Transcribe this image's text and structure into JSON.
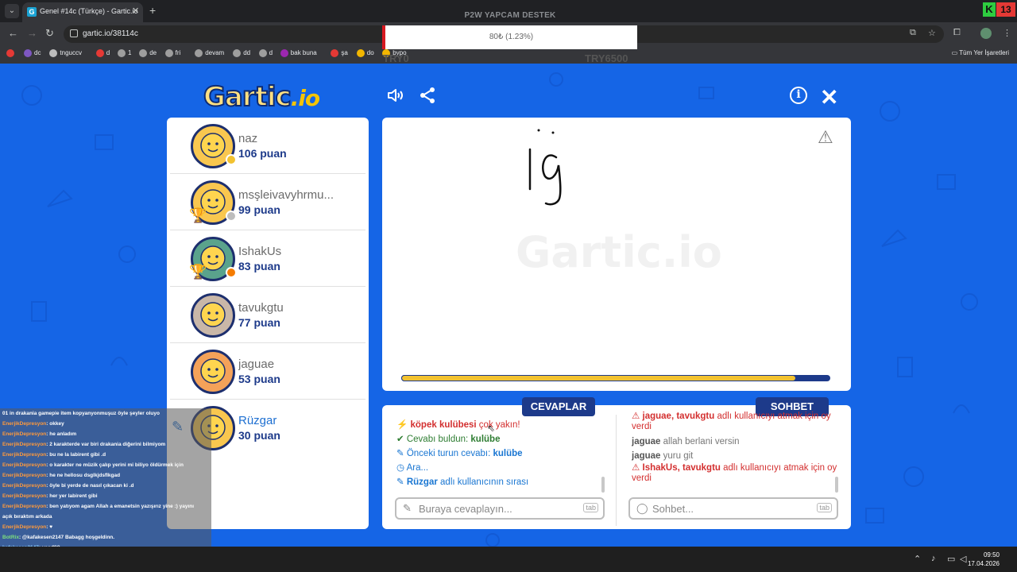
{
  "browser": {
    "tab_title": "Genel #14c (Türkçe) - Gartic.io",
    "tab_favicon": "G",
    "url": "gartic.io/38114c",
    "stream_title": "P2W YAPCAM DESTEK",
    "k_badge": "K",
    "k_number": "13",
    "bookmarks": [
      {
        "label": "",
        "color": "#e53935"
      },
      {
        "label": "dc",
        "color": "#7e57c2"
      },
      {
        "label": "tnguccv",
        "color": "#bdbdbd"
      },
      {
        "label": "d",
        "color": "#e53935"
      },
      {
        "label": "1",
        "color": "#9e9e9e"
      },
      {
        "label": "de",
        "color": "#9e9e9e"
      },
      {
        "label": "fri",
        "color": "#9e9e9e"
      },
      {
        "label": "devam",
        "color": "#9e9e9e"
      },
      {
        "label": "dd",
        "color": "#9e9e9e"
      },
      {
        "label": "d",
        "color": "#9e9e9e"
      },
      {
        "label": "bak buna",
        "color": "#9c27b0"
      },
      {
        "label": "şa",
        "color": "#e53935"
      },
      {
        "label": "do",
        "color": "#f2b600"
      },
      {
        "label": "bypo",
        "color": "#f2b600"
      }
    ],
    "all_bookmarks": "Tüm Yer İşaretleri"
  },
  "donation": {
    "text": "80₺ (1.23%)",
    "min": "TRY0",
    "max": "TRY6500"
  },
  "game": {
    "logo_main": "Gartic",
    "logo_suffix": ".io",
    "watermark": "Gartic.io",
    "timer_fraction": 0.92
  },
  "players": [
    {
      "name": "naz",
      "score": "106 puan",
      "status_color": "#f2c230",
      "trophy": false,
      "avatar_color": "#f9c74f"
    },
    {
      "name": "msşleivavyhrmu...",
      "score": "99 puan",
      "status_color": "#bdbdbd",
      "trophy": true,
      "avatar_color": "#f9c74f"
    },
    {
      "name": "IshakUs",
      "score": "83 puan",
      "status_color": "#f57c00",
      "trophy": true,
      "avatar_color": "#5aa38c"
    },
    {
      "name": "tavukgtu",
      "score": "77 puan",
      "status_color": "",
      "trophy": false,
      "avatar_color": "#c9b7a8"
    },
    {
      "name": "jaguae",
      "score": "53 puan",
      "status_color": "",
      "trophy": false,
      "avatar_color": "#f4a259"
    },
    {
      "name": "Rüzgar",
      "score": "30 puan",
      "status_color": "",
      "trophy": false,
      "avatar_color": "#f9c74f",
      "drawing": true
    }
  ],
  "answers": {
    "tab_label": "CEVAPLAR",
    "lines": [
      {
        "user": "köpek kulübesi",
        "text": " çok yakın!"
      },
      {
        "label": "Cevabı buldun: ",
        "value": "kulübe"
      },
      {
        "label": "Önceki turun cevabı: ",
        "value": "kulübe"
      },
      {
        "text": "Ara..."
      },
      {
        "user": "Rüzgar",
        "text": " adlı kullanıcının sırası"
      }
    ],
    "placeholder": "Buraya cevaplayın...",
    "tab_key": "tab"
  },
  "chat": {
    "tab_label": "SOHBET",
    "lines": [
      {
        "users": "jaguae, tavukgtu",
        "text": " adlı kullanıcıyı atmak için oy verdi"
      },
      {
        "user": "jaguae",
        "text": " allah berlani versin"
      },
      {
        "user": "jaguae",
        "text": " yuru git"
      },
      {
        "users": "IshakUs, tavukgtu",
        "text": " adlı kullanıcıyı atmak için oy verdi"
      }
    ],
    "placeholder": "Sohbet...",
    "tab_key": "tab"
  },
  "stream_chat": [
    {
      "user": "",
      "text": "01 in drakania gamepie item kopyanyonmuşuz öyle şeyler oluyo"
    },
    {
      "user": "EnerjikDepresyon",
      "text": ": okkey"
    },
    {
      "user": "EnerjikDepresyon",
      "text": ": he anladım"
    },
    {
      "user": "EnerjikDepresyon",
      "text": ": 2 karakterde var biri drakania diğerini bilmiyom"
    },
    {
      "user": "EnerjikDepresyon",
      "text": ": bu ne la labirent gibi .d"
    },
    {
      "user": "EnerjikDepresyon",
      "text": ": o karakter ne müzik çalıp yerini mi biliyo öldürmek için"
    },
    {
      "user": "EnerjikDepresyon",
      "text": ": he ne hellosu dsglkjdsflkgad"
    },
    {
      "user": "EnerjikDepresyon",
      "text": ": öyle bi yerde de nasıl çıkacan ki .d"
    },
    {
      "user": "EnerjikDepresyon",
      "text": ": her yer labirent gibi"
    },
    {
      "user": "EnerjikDepresyon",
      "text": ": ben yatıyom agam Allah a emanetsin yazışırız yine :) yayını"
    },
    {
      "user": "",
      "text": "açık bıraktım arkada"
    },
    {
      "user": "EnerjikDepresyon",
      "text": ": ♥"
    },
    {
      "user": "BotRix",
      "text": ": @kafakesen2147 Babagg hoşgeldinn.",
      "style": "bot"
    },
    {
      "user": "kafakesen2147",
      "text": ": vasıf??",
      "style": "u3"
    },
    {
      "user": "kafakesen2147",
      "text": ": unfollow",
      "style": "u3"
    },
    {
      "user": "BotRix",
      "text": ": @Naubot Babagg hoşgeldinn.",
      "style": "bot"
    }
  ],
  "taskbar": {
    "time": "09:50",
    "date": "17.04.2026"
  }
}
